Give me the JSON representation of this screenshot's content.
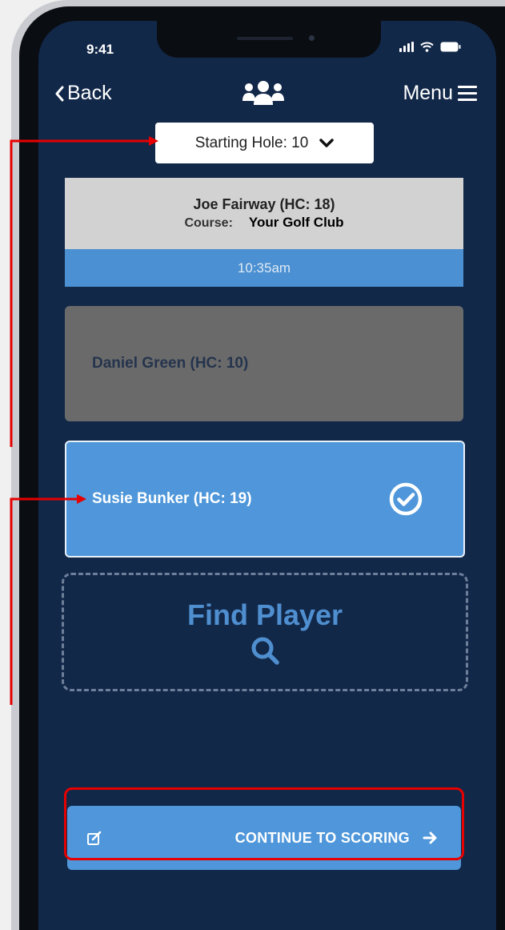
{
  "status_bar": {
    "time": "9:41"
  },
  "nav": {
    "back_label": "Back",
    "menu_label": "Menu"
  },
  "starting_hole": {
    "label": "Starting Hole: 10"
  },
  "player_card_joe": {
    "name": "Joe Fairway (HC: 18)",
    "course_label": "Course:",
    "course_value": "Your Golf Club",
    "tee_time": "10:35am"
  },
  "player_card_daniel": {
    "name": "Daniel Green (HC: 10)"
  },
  "player_card_susie": {
    "name": "Susie Bunker (HC: 19)",
    "selected": true
  },
  "find_player": {
    "label": "Find Player"
  },
  "continue_button": {
    "label": "CONTINUE TO SCORING"
  },
  "colors": {
    "screen_bg": "#122849",
    "accent_blue": "#4f97da",
    "annotation_red": "#e60000",
    "disabled_gray": "#6a6a6a"
  },
  "icons": [
    "group-icon",
    "chevron-left-icon",
    "hamburger-icon",
    "chevron-down-icon",
    "check-circle-icon",
    "search-icon",
    "edit-icon",
    "arrow-right-icon"
  ]
}
